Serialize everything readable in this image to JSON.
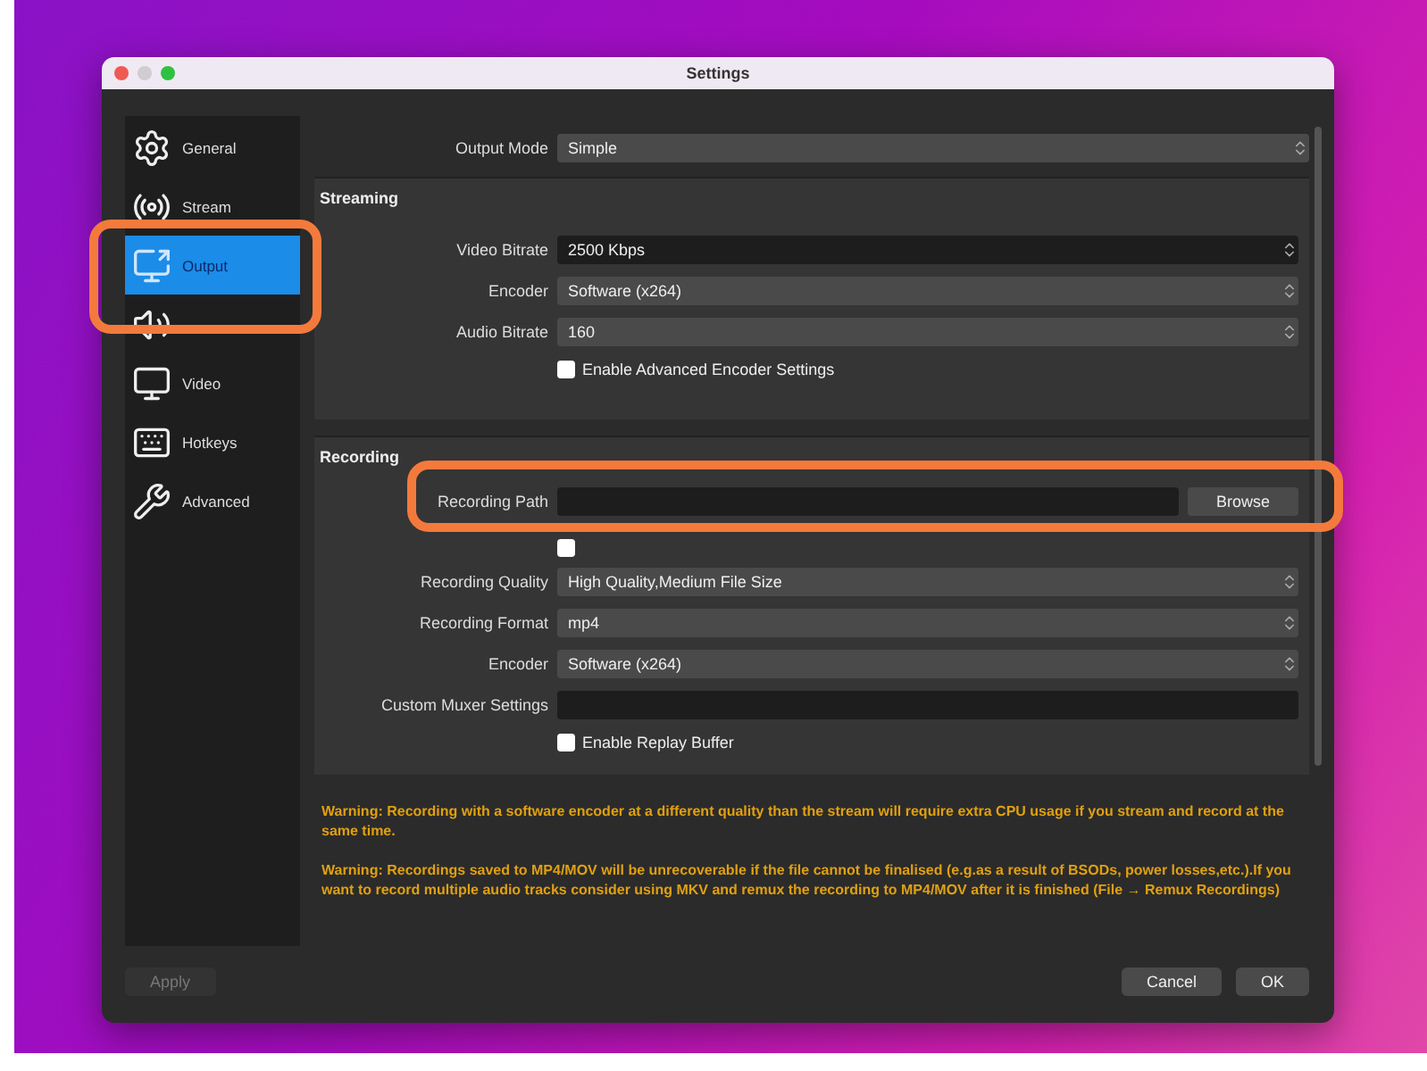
{
  "window": {
    "title": "Settings"
  },
  "sidebar": {
    "items": [
      {
        "kind": "general",
        "label": "General",
        "selected": false
      },
      {
        "kind": "stream",
        "label": "Stream",
        "selected": false
      },
      {
        "kind": "output",
        "label": "Output",
        "selected": true
      },
      {
        "kind": "audio",
        "selected": false
      },
      {
        "kind": "video",
        "label": "Video",
        "selected": false
      },
      {
        "kind": "hotkeys",
        "label": "Hotkeys",
        "selected": false
      },
      {
        "kind": "advanced",
        "label": "Advanced",
        "selected": false
      }
    ]
  },
  "output_mode": {
    "label": "Output Mode",
    "value": "Simple"
  },
  "streaming": {
    "title": "Streaming",
    "rows": [
      {
        "kind": "spin",
        "label": "Video Bitrate",
        "value": "2500 Kbps"
      },
      {
        "kind": "select",
        "label": "Encoder",
        "value": "Software (x264)"
      },
      {
        "kind": "select",
        "label": "Audio Bitrate",
        "value": "160"
      },
      {
        "kind": "checkbox",
        "label": "Enable Advanced Encoder Settings",
        "checked": false
      }
    ]
  },
  "recording": {
    "title": "Recording",
    "rows": [
      {
        "kind": "path",
        "label": "Recording Path",
        "button": "Browse"
      },
      {
        "kind": "checkbox",
        "checked": false
      },
      {
        "kind": "select",
        "label": "Recording Quality",
        "value": "High Quality,Medium File Size"
      },
      {
        "kind": "select",
        "label": "Recording Format",
        "value": "mp4"
      },
      {
        "kind": "select",
        "label": "Encoder",
        "value": "Software (x264)"
      },
      {
        "kind": "text",
        "label": "Custom Muxer Settings"
      },
      {
        "kind": "checkbox",
        "label": "Enable Replay Buffer",
        "checked": false
      }
    ]
  },
  "warnings": [
    "Warning: Recording with a software encoder at a different quality than the stream will require extra CPU usage if you stream and record at the same time.",
    "Warning: Recordings saved to MP4/MOV will be unrecoverable if the file cannot be finalised (e.g.as a result of BSODs, power losses,etc.).If you want to record multiple audio tracks consider using MKV and remux the recording to MP4/MOV after it is finished (File → Remux Recordings)"
  ],
  "buttons": {
    "apply": {
      "label": "Apply",
      "disabled": true
    },
    "cancel": {
      "label": "Cancel"
    },
    "ok": {
      "label": "OK"
    }
  }
}
